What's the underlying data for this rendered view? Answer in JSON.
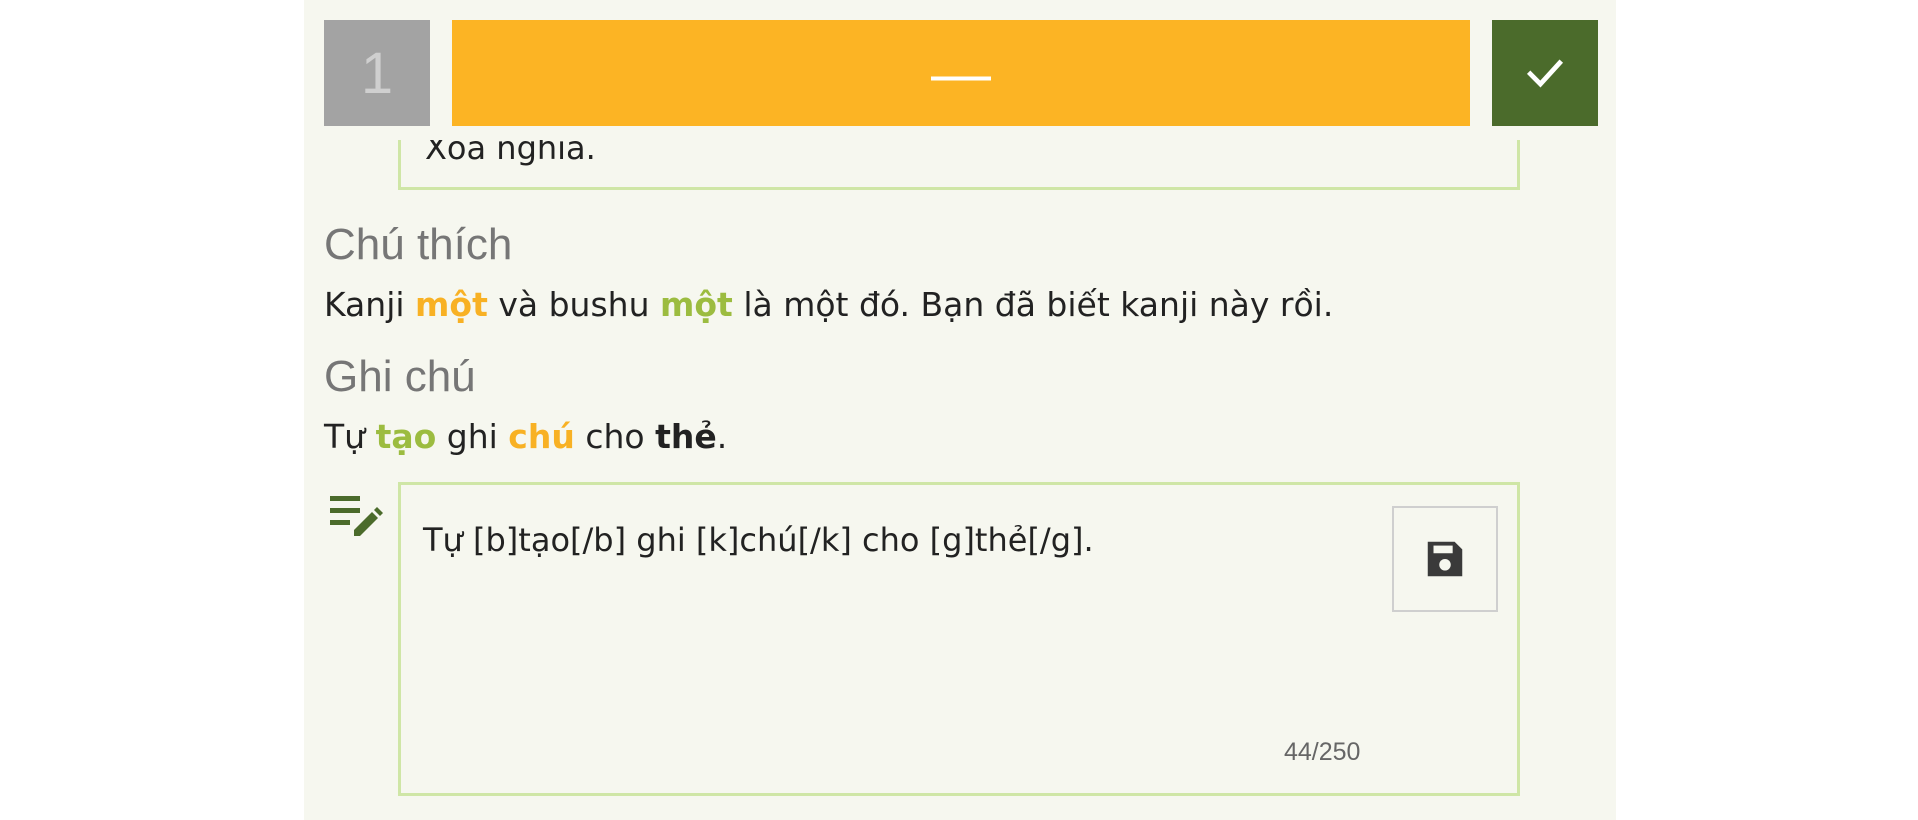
{
  "header": {
    "counter": "1",
    "answer": "—",
    "check_icon": "check-icon"
  },
  "meaning": {
    "partial_text": "Xóa nghĩa."
  },
  "explanation": {
    "title": "Chú thích",
    "parts": {
      "p1": "Kanji ",
      "h1": "một",
      "p2": " và bushu ",
      "h2": "một",
      "p3": " là một đó. Bạn đã biết kanji này rồi."
    }
  },
  "note": {
    "title": "Ghi chú",
    "parts": {
      "p1": "Tự ",
      "h1": "tạo",
      "p2": " ghi ",
      "h2": "chú",
      "p3": " cho ",
      "h3": "thẻ",
      "p4": "."
    },
    "edit_icon": "edit-note-icon",
    "input_value": "Tự [b]tạo[/b] ghi [k]chú[/k] cho [g]thẻ[/g].",
    "save_icon": "save-icon",
    "char_count": "44/250"
  },
  "colors": {
    "background": "#f6f7ef",
    "answer_bar": "#fcb424",
    "check_button": "#4b6b2b",
    "counter": "#a3a3a3",
    "border": "#cfe6a6",
    "highlight_orange": "#f8b124",
    "highlight_green": "#9cbc40"
  }
}
